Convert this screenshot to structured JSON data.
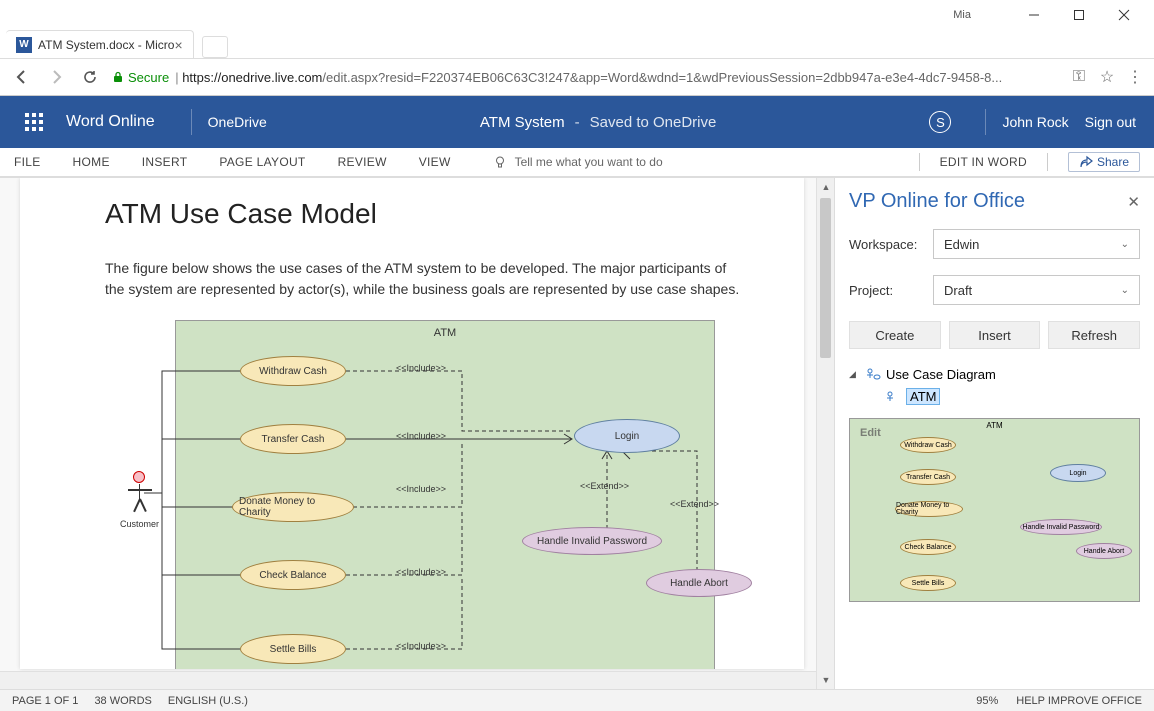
{
  "os": {
    "user": "Mia"
  },
  "browser": {
    "tab_title": "ATM System.docx - Micro",
    "tab_favicon": "W",
    "secure_label": "Secure",
    "url_host": "https://onedrive.live.com",
    "url_path": "/edit.aspx?resid=F220374EB06C63C3!247&app=Word&wdnd=1&wdPreviousSession=2dbb947a-e3e4-4dc7-9458-8..."
  },
  "word_header": {
    "app": "Word Online",
    "location": "OneDrive",
    "doc_title": "ATM System",
    "saved": "Saved to OneDrive",
    "user": "John Rock",
    "signout": "Sign out",
    "skype": "S"
  },
  "ribbon": {
    "tabs": [
      "FILE",
      "HOME",
      "INSERT",
      "PAGE LAYOUT",
      "REVIEW",
      "VIEW"
    ],
    "tellme": "Tell me what you want to do",
    "edit_in_word": "EDIT IN WORD",
    "share": "Share"
  },
  "document": {
    "heading": "ATM Use Case Model",
    "paragraph": "The figure below shows the use cases of the ATM system to be developed. The major participants of the system are represented by actor(s), while the business goals are represented by use case shapes.",
    "diagram": {
      "title": "ATM",
      "actor": "Customer",
      "usecases_yellow": [
        "Withdraw Cash",
        "Transfer Cash",
        "Donate Money to Charity",
        "Check Balance",
        "Settle Bills"
      ],
      "usecase_login": "Login",
      "usecase_invalid": "Handle Invalid Password",
      "usecase_abort": "Handle Abort",
      "include": "<<Include>>",
      "extend": "<<Extend>>"
    }
  },
  "vp": {
    "title": "VP Online for Office",
    "workspace_label": "Workspace:",
    "workspace_value": "Edwin",
    "project_label": "Project:",
    "project_value": "Draft",
    "btn_create": "Create",
    "btn_insert": "Insert",
    "btn_refresh": "Refresh",
    "tree_root": "Use Case Diagram",
    "tree_child": "ATM",
    "thumb_edit": "Edit",
    "thumb_title": "ATM"
  },
  "status": {
    "page": "PAGE 1 OF 1",
    "words": "38 WORDS",
    "lang": "ENGLISH (U.S.)",
    "zoom": "95%",
    "help": "HELP IMPROVE OFFICE"
  }
}
